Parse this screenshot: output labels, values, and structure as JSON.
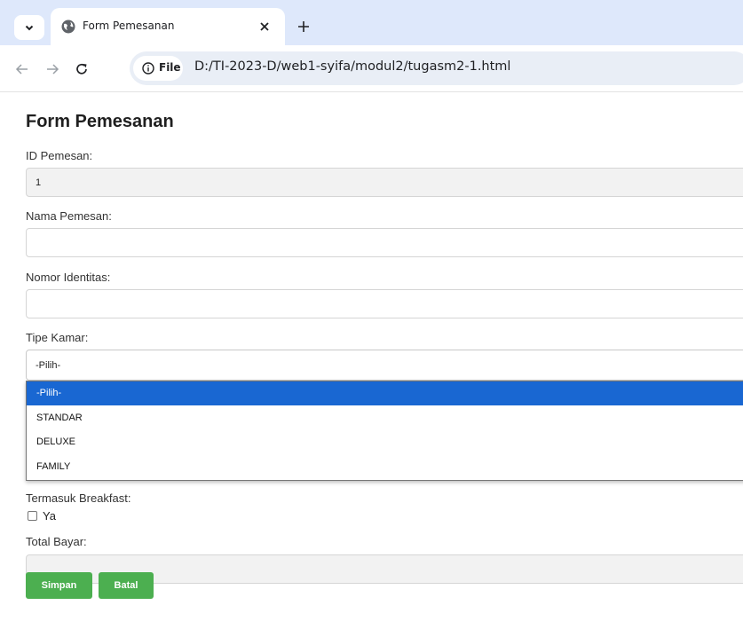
{
  "browser": {
    "tab_title": "Form Pemesanan",
    "site_chip_label": "File",
    "url": "D:/TI-2023-D/web1-syifa/modul2/tugasm2-1.html",
    "icons": [
      "chevron-down-icon",
      "globe-icon",
      "close-icon",
      "plus-icon",
      "back-arrow-icon",
      "forward-arrow-icon",
      "reload-icon",
      "info-icon"
    ]
  },
  "form": {
    "title": "Form Pemesanan",
    "id_pemesan": {
      "label": "ID Pemesan:",
      "value": "1"
    },
    "nama_pemesan": {
      "label": "Nama Pemesan:",
      "value": ""
    },
    "nomor_identitas": {
      "label": "Nomor Identitas:",
      "value": ""
    },
    "tipe_kamar": {
      "label": "Tipe Kamar:",
      "selected": "-Pilih-",
      "options": [
        "-Pilih-",
        "STANDAR",
        "DELUXE",
        "FAMILY"
      ]
    },
    "breakfast": {
      "label": "Termasuk Breakfast:",
      "option_label": "Ya",
      "checked": false
    },
    "total_bayar": {
      "label": "Total Bayar:",
      "value": ""
    },
    "buttons": {
      "save": "Simpan",
      "cancel": "Batal"
    }
  },
  "colors": {
    "tabstrip": "#dee8fb",
    "omnibox": "#e9eef6",
    "button_green": "#4caf50",
    "dropdown_highlight": "#1967d2"
  }
}
